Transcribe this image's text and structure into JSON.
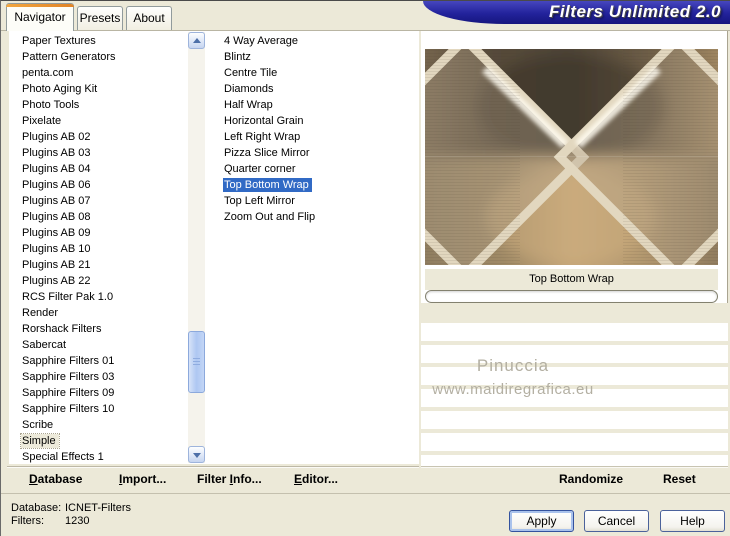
{
  "banner": {
    "title": "Filters Unlimited 2.0"
  },
  "tabs": {
    "items": [
      "Navigator",
      "Presets",
      "About"
    ],
    "active_index": 0
  },
  "category_list": {
    "items": [
      "Paper Textures",
      "Pattern Generators",
      "penta.com",
      "Photo Aging Kit",
      "Photo Tools",
      "Pixelate",
      "Plugins AB 02",
      "Plugins AB 03",
      "Plugins AB 04",
      "Plugins AB 06",
      "Plugins AB 07",
      "Plugins AB 08",
      "Plugins AB 09",
      "Plugins AB 10",
      "Plugins AB 21",
      "Plugins AB 22",
      "RCS Filter Pak 1.0",
      "Render",
      "Rorshack Filters",
      "Sabercat",
      "Sapphire Filters 01",
      "Sapphire Filters 03",
      "Sapphire Filters 09",
      "Sapphire Filters 10",
      "Scribe",
      "Simple",
      "Special Effects 1"
    ],
    "selected_index": 25,
    "selected_item": "Simple"
  },
  "filter_list": {
    "items": [
      "4 Way Average",
      "Blintz",
      "Centre Tile",
      "Diamonds",
      "Half Wrap",
      "Horizontal Grain",
      "Left Right Wrap",
      "Pizza Slice Mirror",
      "Quarter corner",
      "Top Bottom Wrap",
      "Top Left Mirror",
      "Zoom Out and Flip"
    ],
    "selected_index": 9,
    "selected_item": "Top Bottom Wrap"
  },
  "preview": {
    "filter_name_label": "Top Bottom Wrap",
    "watermark_line1": "Pinuccia",
    "watermark_line2": "www.maidiregrafica.eu"
  },
  "panel_actions": {
    "randomize": "Randomize",
    "reset": "Reset"
  },
  "menu": {
    "items": [
      {
        "pre": "",
        "accel": "D",
        "post": "atabase"
      },
      {
        "pre": "",
        "accel": "I",
        "post": "mport..."
      },
      {
        "pre": "Filter ",
        "accel": "I",
        "post": "nfo..."
      },
      {
        "pre": "",
        "accel": "E",
        "post": "ditor..."
      }
    ]
  },
  "status": {
    "database_label": "Database:",
    "database_value": "ICNET-Filters",
    "filters_label": "Filters:",
    "filters_value": "1230"
  },
  "dialog_buttons": {
    "apply": "Apply",
    "cancel": "Cancel",
    "help": "Help"
  },
  "colors": {
    "dialog_bg": "#ECE9D8",
    "selection_blue": "#316AC5",
    "banner_blue": "#22229B",
    "tab_accent_orange": "#E8912D",
    "watermark_gray": "#B3AFA2"
  }
}
